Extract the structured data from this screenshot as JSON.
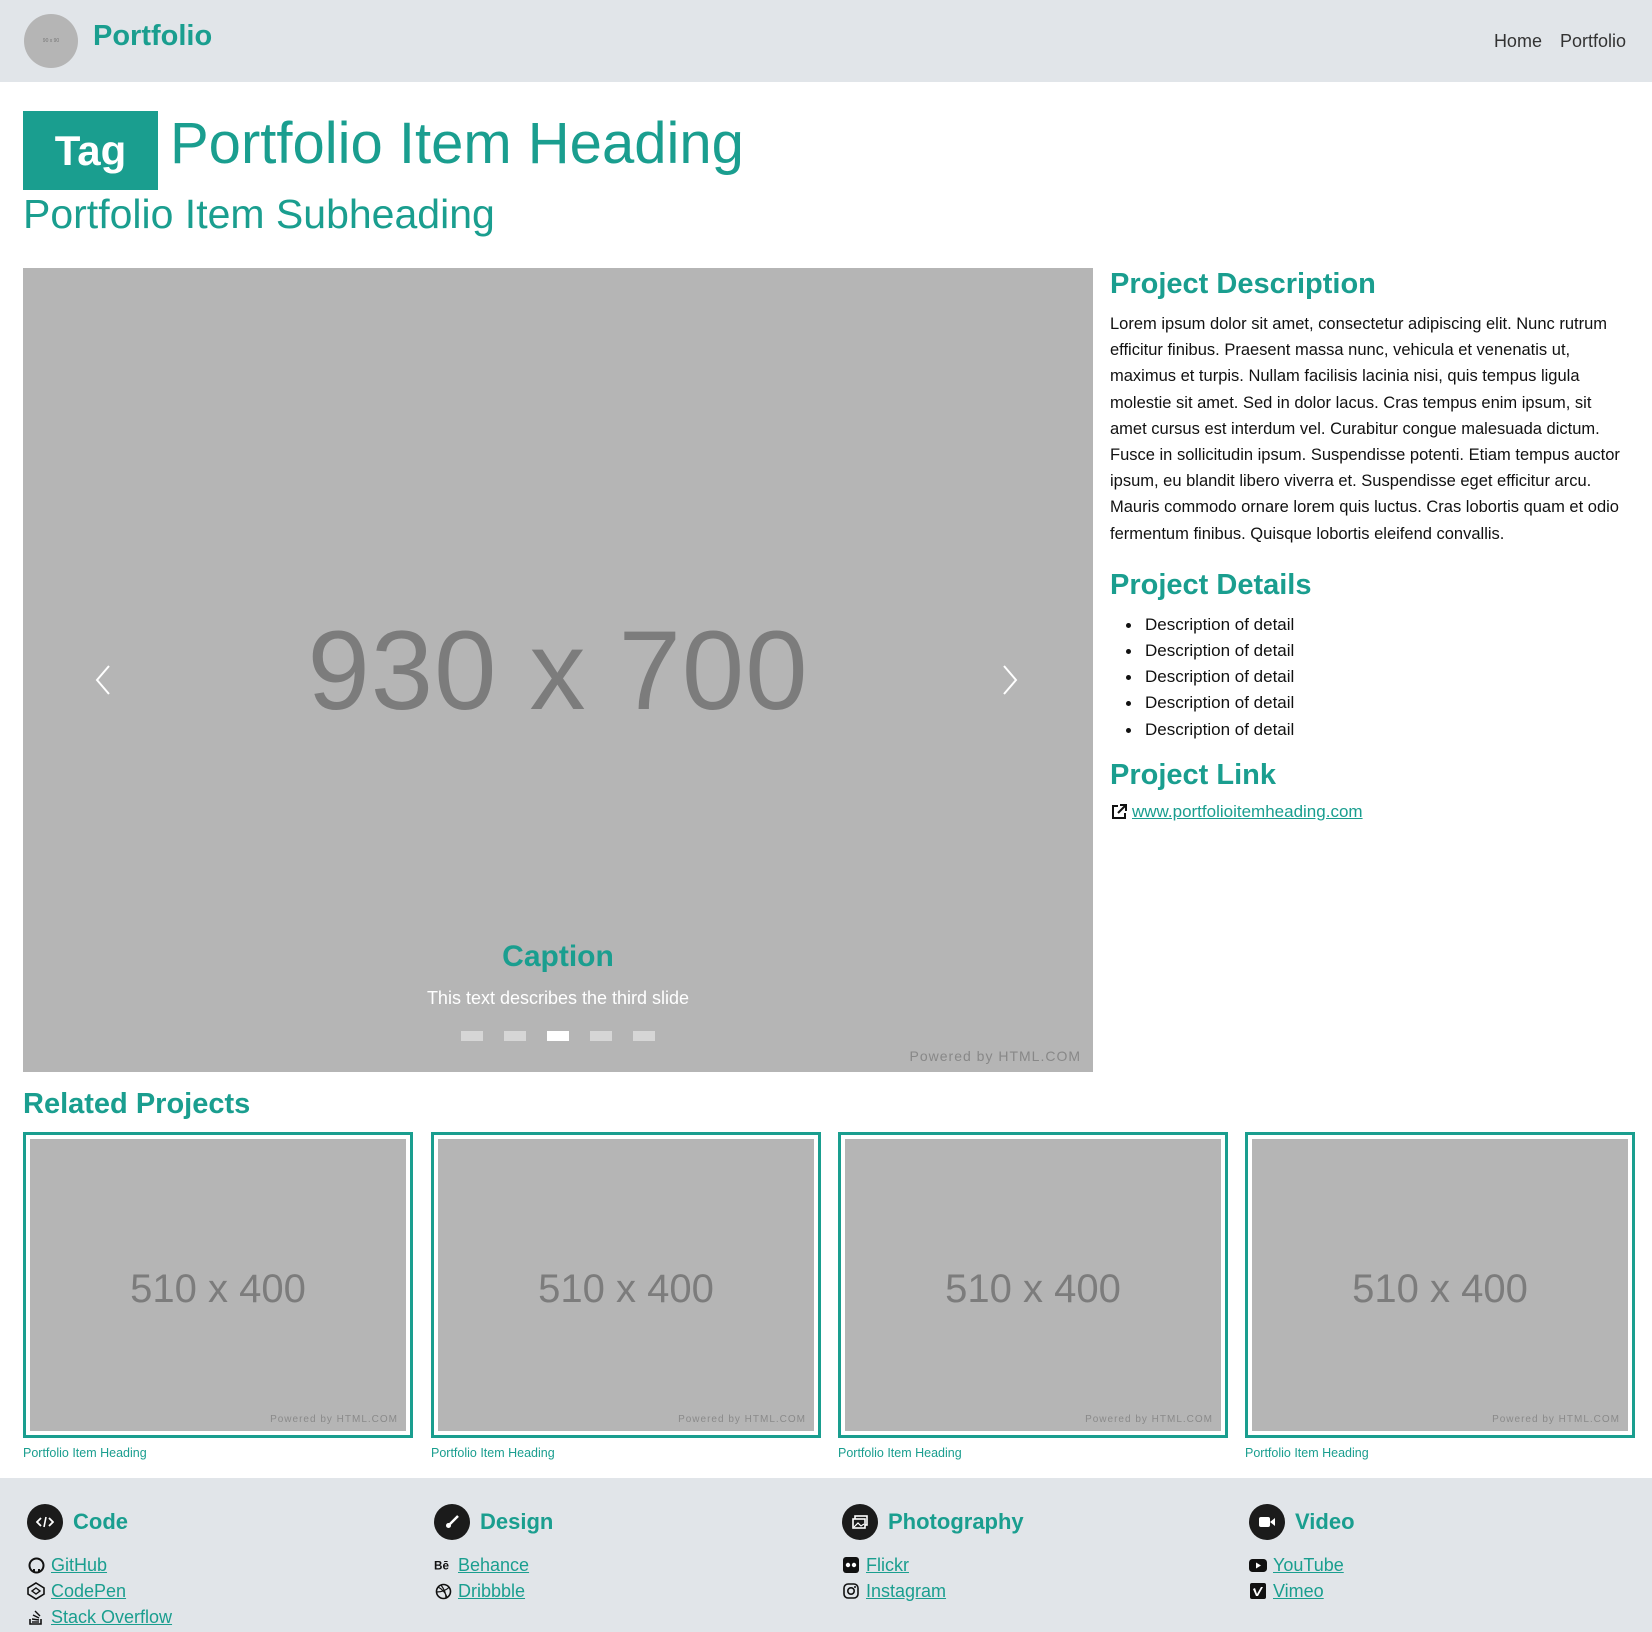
{
  "navbar": {
    "logo_text": "90 x 90",
    "brand": "Portfolio",
    "links": [
      "Home",
      "Portfolio"
    ]
  },
  "heading": {
    "tag": "Tag",
    "title": "Portfolio Item Heading",
    "subtitle": "Portfolio Item Subheading"
  },
  "carousel": {
    "image_dims": "930 x 700",
    "caption_title": "Caption",
    "caption_text": "This text describes the third slide",
    "slide_count": 5,
    "active_slide": 3,
    "powered": "Powered by HTML.COM"
  },
  "description": {
    "title": "Project Description",
    "text": "Lorem ipsum dolor sit amet, consectetur adipiscing elit. Nunc rutrum efficitur finibus. Praesent massa nunc, vehicula et venenatis ut, maximus et turpis. Nullam facilisis lacinia nisi, quis tempus ligula molestie sit amet. Sed in dolor lacus. Cras tempus enim ipsum, sit amet cursus est interdum vel. Curabitur congue malesuada dictum. Fusce in sollicitudin ipsum. Suspendisse potenti. Etiam tempus auctor ipsum, eu blandit libero viverra et. Suspendisse eget efficitur arcu. Mauris commodo ornare lorem quis luctus. Cras lobortis quam et odio fermentum finibus. Quisque lobortis eleifend convallis."
  },
  "details": {
    "title": "Project Details",
    "items": [
      "Description of detail",
      "Description of detail",
      "Description of detail",
      "Description of detail",
      "Description of detail"
    ]
  },
  "link": {
    "title": "Project Link",
    "url_text": "www.portfolioitemheading.com"
  },
  "related": {
    "title": "Related Projects",
    "cards": [
      {
        "dims": "510 x 400",
        "powered": "Powered by HTML.COM",
        "label": "Portfolio Item Heading"
      },
      {
        "dims": "510 x 400",
        "powered": "Powered by HTML.COM",
        "label": "Portfolio Item Heading"
      },
      {
        "dims": "510 x 400",
        "powered": "Powered by HTML.COM",
        "label": "Portfolio Item Heading"
      },
      {
        "dims": "510 x 400",
        "powered": "Powered by HTML.COM",
        "label": "Portfolio Item Heading"
      }
    ]
  },
  "footer": {
    "columns": [
      {
        "title": "Code",
        "icon": "code-icon",
        "links": [
          {
            "label": "GitHub",
            "icon": "github-icon"
          },
          {
            "label": "CodePen",
            "icon": "codepen-icon"
          },
          {
            "label": "Stack Overflow",
            "icon": "stackoverflow-icon"
          }
        ]
      },
      {
        "title": "Design",
        "icon": "brush-icon",
        "links": [
          {
            "label": "Behance",
            "icon": "behance-icon"
          },
          {
            "label": "Dribbble",
            "icon": "dribbble-icon"
          }
        ]
      },
      {
        "title": "Photography",
        "icon": "images-icon",
        "links": [
          {
            "label": "Flickr",
            "icon": "flickr-icon"
          },
          {
            "label": "Instagram",
            "icon": "instagram-icon"
          }
        ]
      },
      {
        "title": "Video",
        "icon": "video-icon",
        "links": [
          {
            "label": "YouTube",
            "icon": "youtube-icon"
          },
          {
            "label": "Vimeo",
            "icon": "vimeo-icon"
          }
        ]
      }
    ]
  },
  "colors": {
    "accent": "#1a9e8f",
    "placeholder": "#b5b5b5",
    "navbar_bg": "#e1e5e9"
  }
}
